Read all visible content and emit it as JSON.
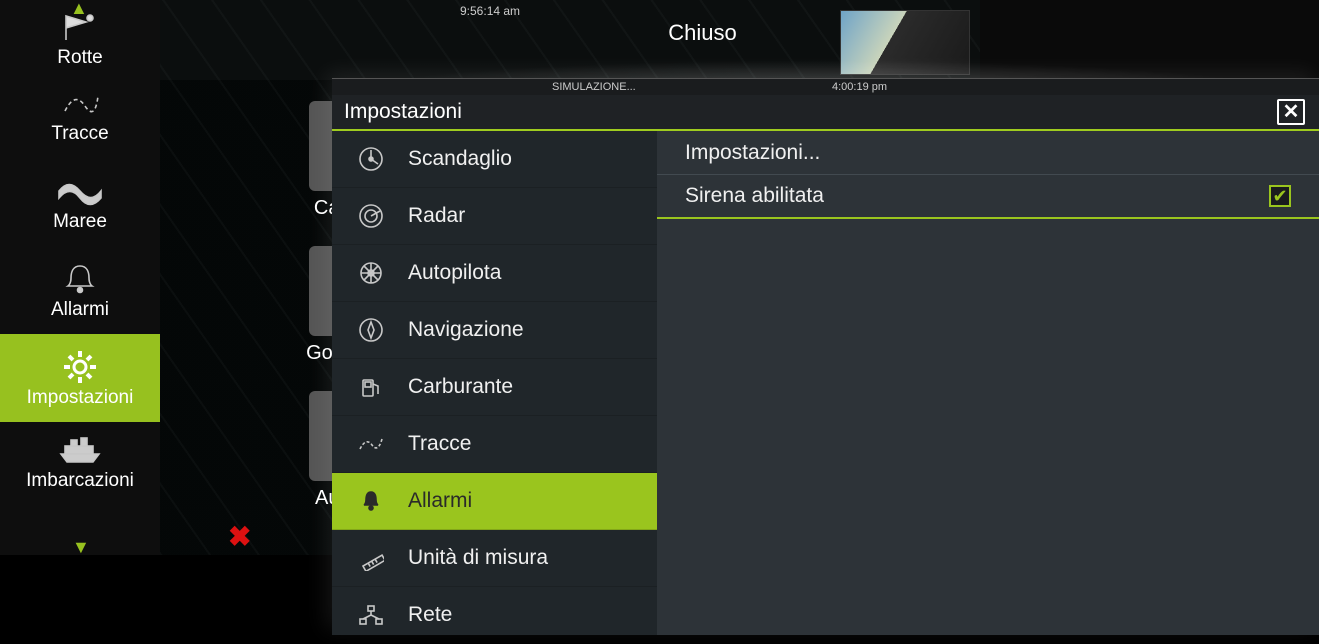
{
  "background": {
    "time_top": "9:56:14 am",
    "chiuso": "Chiuso",
    "mid_tiles": [
      "Car",
      "Gove",
      "Aut"
    ]
  },
  "sidebar": {
    "items": [
      {
        "label": "Rotte",
        "icon": "flag-route-icon"
      },
      {
        "label": "Tracce",
        "icon": "tracks-icon"
      },
      {
        "label": "Maree",
        "icon": "wave-icon"
      },
      {
        "label": "Allarmi",
        "icon": "bell-icon"
      },
      {
        "label": "Impostazioni",
        "icon": "gear-icon",
        "active": true
      },
      {
        "label": "Imbarcazioni",
        "icon": "ship-icon"
      }
    ]
  },
  "dialog": {
    "sim_label": "SIMULAZIONE...",
    "time": "4:00:19 pm",
    "title": "Impostazioni",
    "nav": [
      {
        "label": "Scandaglio",
        "icon": "sonar-icon"
      },
      {
        "label": "Radar",
        "icon": "radar-icon"
      },
      {
        "label": "Autopilota",
        "icon": "wheel-icon"
      },
      {
        "label": "Navigazione",
        "icon": "compass-icon"
      },
      {
        "label": "Carburante",
        "icon": "fuel-icon"
      },
      {
        "label": "Tracce",
        "icon": "tracks-icon"
      },
      {
        "label": "Allarmi",
        "icon": "bell-icon",
        "active": true
      },
      {
        "label": "Unità di misura",
        "icon": "ruler-icon"
      },
      {
        "label": "Rete",
        "icon": "network-icon"
      }
    ],
    "content": {
      "settings_more": "Impostazioni...",
      "siren_label": "Sirena abilitata",
      "siren_checked": true
    }
  }
}
